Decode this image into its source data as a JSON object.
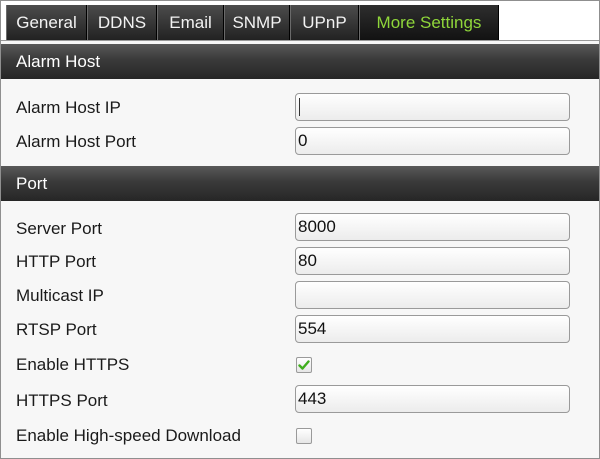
{
  "tabs": [
    {
      "label": "General",
      "active": false
    },
    {
      "label": "DDNS",
      "active": false
    },
    {
      "label": "Email",
      "active": false
    },
    {
      "label": "SNMP",
      "active": false
    },
    {
      "label": "UPnP",
      "active": false
    },
    {
      "label": "More Settings",
      "active": true
    }
  ],
  "alarm_host": {
    "header": "Alarm Host",
    "ip_label": "Alarm Host IP",
    "ip_value": "",
    "port_label": "Alarm Host Port",
    "port_value": "0"
  },
  "port": {
    "header": "Port",
    "server_port_label": "Server Port",
    "server_port_value": "8000",
    "http_port_label": "HTTP Port",
    "http_port_value": "80",
    "multicast_ip_label": "Multicast IP",
    "multicast_ip_value": "",
    "rtsp_port_label": "RTSP Port",
    "rtsp_port_value": "554",
    "enable_https_label": "Enable HTTPS",
    "enable_https_checked": true,
    "https_port_label": "HTTPS Port",
    "https_port_value": "443",
    "high_speed_download_label": "Enable High-speed Download",
    "high_speed_download_checked": false
  },
  "colors": {
    "active_tab_text": "#8fd63a",
    "checkmark": "#3fae1c"
  }
}
